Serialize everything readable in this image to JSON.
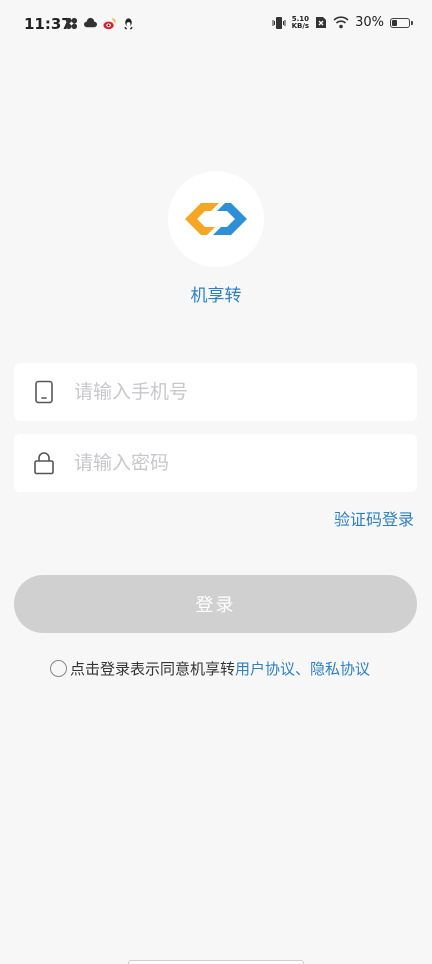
{
  "status_bar": {
    "time": "11:37",
    "speed_value": "5.10",
    "speed_unit": "KB/s",
    "battery": "30%",
    "battery_level": 0.3
  },
  "app": {
    "name": "机享转",
    "brand_blue": "#2d7fc6",
    "brand_orange": "#f5a623"
  },
  "form": {
    "phone_placeholder": "请输入手机号",
    "password_placeholder": "请输入密码",
    "verify_login_label": "验证码登录",
    "login_label": "登录"
  },
  "agreement": {
    "prefix": "点击登录表示同意机享转",
    "user_agreement": "用户协议",
    "separator": "、",
    "privacy_agreement": "隐私协议"
  }
}
